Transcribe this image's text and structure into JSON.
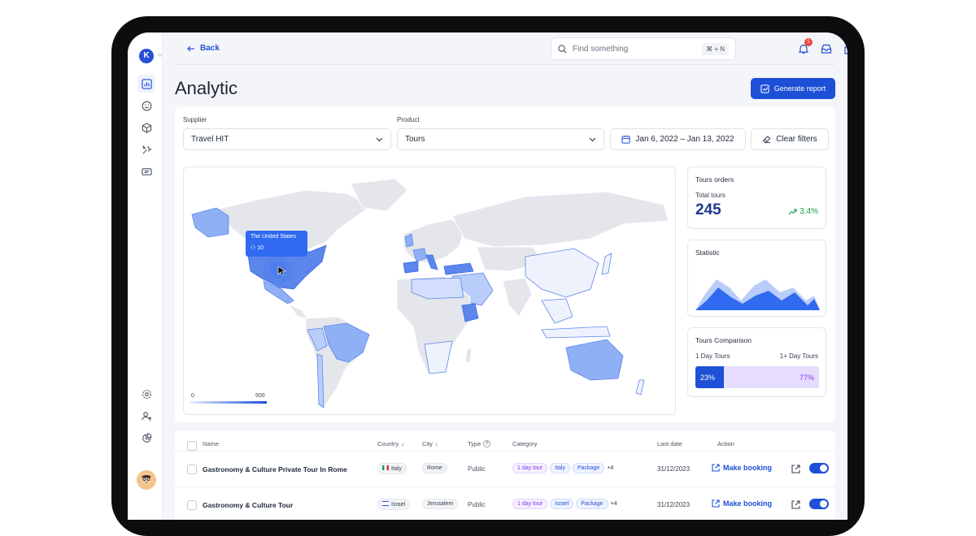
{
  "nav": {
    "back_label": "Back"
  },
  "search": {
    "placeholder": "Find something",
    "shortcut": "⌘ + N"
  },
  "notifications": {
    "count": "5"
  },
  "page": {
    "title": "Analytic",
    "generate_label": "Generate report"
  },
  "filters": {
    "supplier_label": "Supplier",
    "supplier_value": "Travel HIT",
    "product_label": "Product",
    "product_value": "Tours",
    "date_range": "Jan 6, 2022 – Jan 13, 2022",
    "clear_label": "Clear filters"
  },
  "map": {
    "tooltip_country": "The United States",
    "tooltip_value": "10",
    "legend_min": "0",
    "legend_max": "500",
    "accent": "#2f6af0"
  },
  "tours_orders": {
    "title": "Tours orders",
    "label": "Total tours",
    "value": "245",
    "trend": "3.4%"
  },
  "statistic": {
    "title": "Statistic"
  },
  "comparison": {
    "title": "Tours Comparison",
    "left_label": "1 Day Tours",
    "right_label": "1+ Day Tours",
    "left_value": "23%",
    "right_value": "77%",
    "left_fraction": 0.23
  },
  "table": {
    "headers": {
      "name": "Name",
      "country": "Country",
      "city": "City",
      "type": "Type",
      "category": "Category",
      "last_date": "Last date",
      "action": "Action"
    },
    "rows": [
      {
        "name": "Gastronomy & Culture Private Tour In Rome",
        "country": "Italy",
        "city": "Rome",
        "type": "Public",
        "categories": [
          "1 day tour",
          "Italy",
          "Package"
        ],
        "more": "+4",
        "last_date": "31/12/2023",
        "action": "Make booking"
      },
      {
        "name": "Gastronomy & Culture Tour",
        "country": "Israel",
        "city": "Jerusalem",
        "type": "Public",
        "categories": [
          "1 day tour",
          "Israel",
          "Package"
        ],
        "more": "+4",
        "last_date": "31/12/2023",
        "action": "Make booking"
      }
    ]
  }
}
